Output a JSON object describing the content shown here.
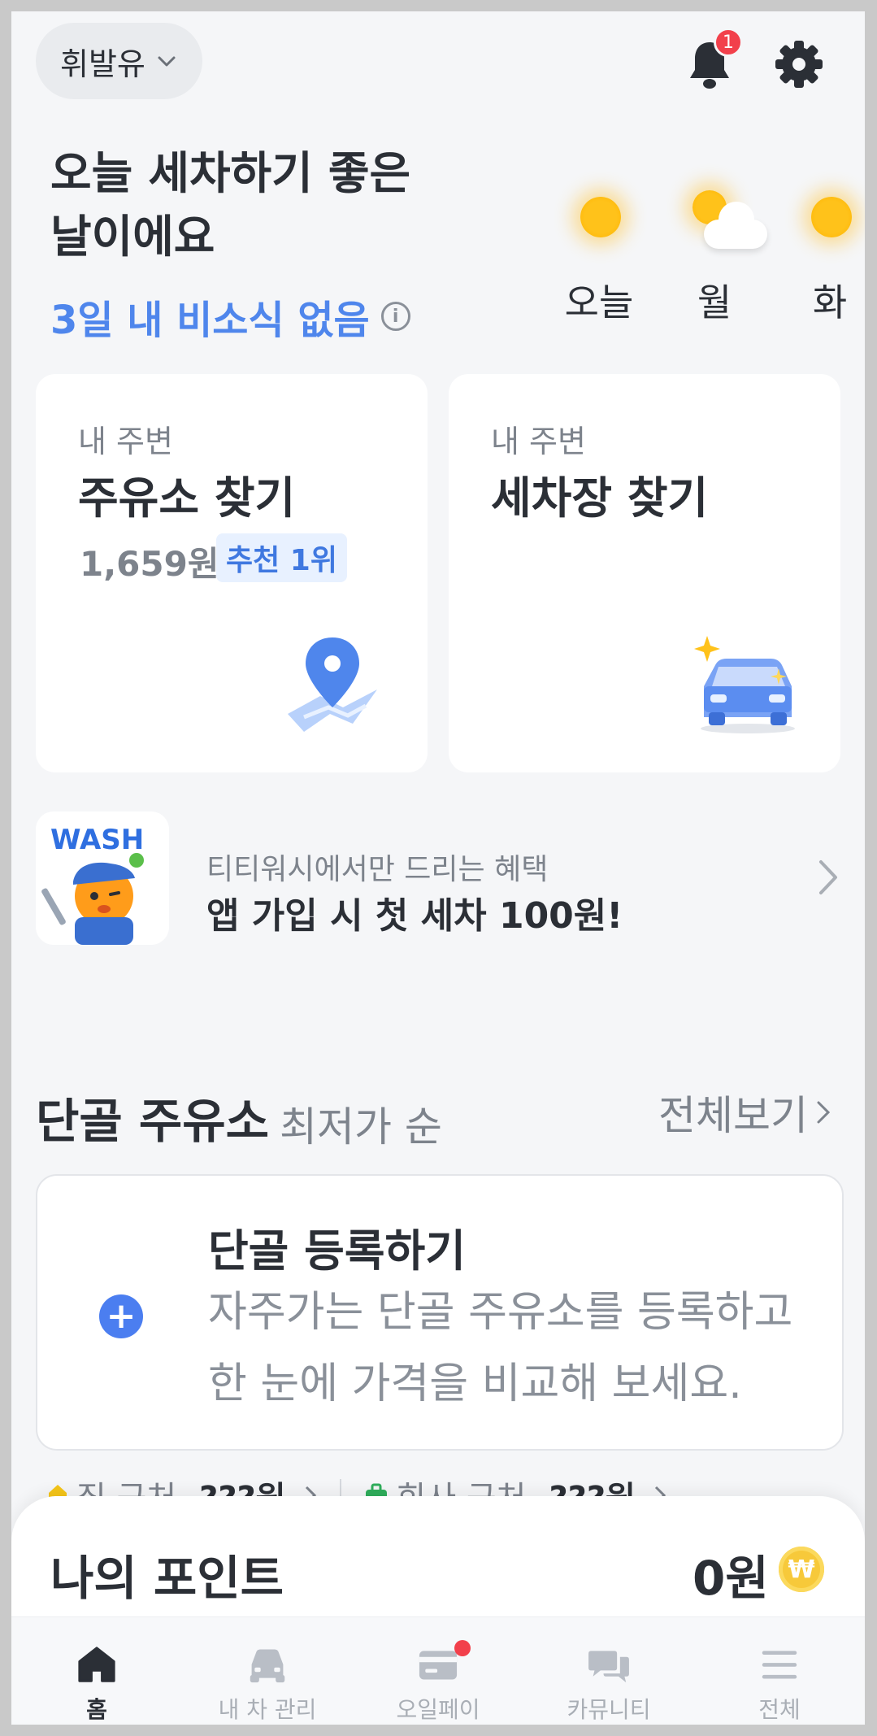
{
  "header": {
    "fuel_type": "휘발유",
    "notification_count": "1"
  },
  "weather": {
    "headline_line1": "오늘 세차하기 좋은",
    "headline_line2": "날이에요",
    "rain_note": "3일 내 비소식 없음",
    "forecast": [
      {
        "label": "오늘",
        "icon": "sunny-icon"
      },
      {
        "label": "월",
        "icon": "partly-cloudy-icon"
      },
      {
        "label": "화",
        "icon": "sunny-icon"
      }
    ]
  },
  "cards": {
    "gas": {
      "sub": "내 주변",
      "title": "주유소 찾기",
      "price": "1,659원",
      "badge": "추천 1위"
    },
    "wash": {
      "sub": "내 주변",
      "title": "세차장 찾기"
    }
  },
  "promo": {
    "logo_text": "WASH",
    "sub": "티티워시에서만 드리는 혜택",
    "title": "앱 가입 시 첫 세차 100원!"
  },
  "favorites": {
    "title": "단골 주유소",
    "sort": "최저가 순",
    "more": "전체보기",
    "register_title": "단골 등록하기",
    "register_desc_line1": "자주가는 단골 주유소를 등록하고",
    "register_desc_line2": "한 눈에 가격을 비교해 보세요.",
    "home_label": "집 근처",
    "home_price": "???원",
    "work_label": "회사 근처",
    "work_price": "???원"
  },
  "points": {
    "label": "나의 포인트",
    "value": "0원",
    "coin_symbol": "₩"
  },
  "nav": [
    {
      "label": "홈",
      "active": true
    },
    {
      "label": "내 차 관리",
      "active": false
    },
    {
      "label": "오일페이",
      "active": false
    },
    {
      "label": "카뮤니티",
      "active": false
    },
    {
      "label": "전체",
      "active": false
    }
  ],
  "colors": {
    "accent_blue": "#4f86ec",
    "badge_red": "#f2404b",
    "background": "#f5f6f8"
  }
}
